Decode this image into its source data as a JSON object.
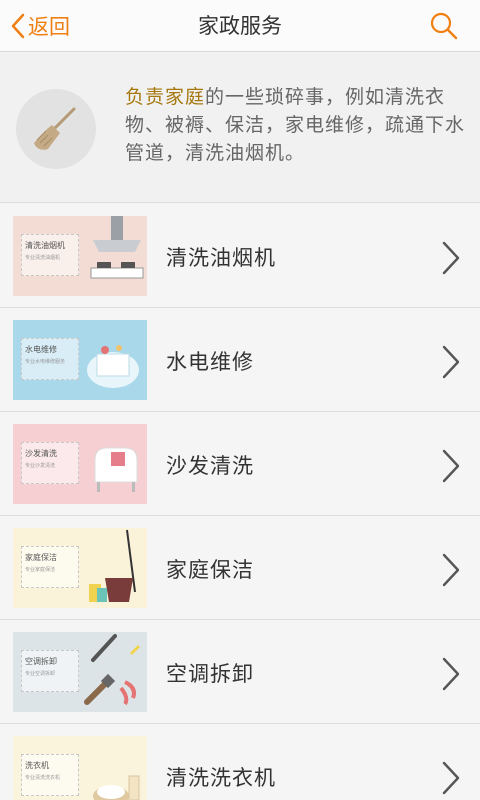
{
  "header": {
    "back_label": "返回",
    "title": "家政服务"
  },
  "intro": {
    "highlight": "负责家庭",
    "text": "的一些琐碎事，例如清洗衣物、被褥、保洁，家电维修，疏通下水管道，清洗油烟机。"
  },
  "services": [
    {
      "label": "清洗油烟机",
      "thumb_title": "清洗油烟机",
      "thumb_sub": "专业清洗油烟机",
      "thumb_bg": "#f2dcd3"
    },
    {
      "label": "水电维修",
      "thumb_title": "水电维修",
      "thumb_sub": "专业水电维修服务",
      "thumb_bg": "#a9d8ea"
    },
    {
      "label": "沙发清洗",
      "thumb_title": "沙发清洗",
      "thumb_sub": "专业沙发清洗",
      "thumb_bg": "#f6cfd3"
    },
    {
      "label": "家庭保洁",
      "thumb_title": "家庭保洁",
      "thumb_sub": "专业家庭保洁",
      "thumb_bg": "#faf3d9"
    },
    {
      "label": "空调拆卸",
      "thumb_title": "空调拆卸",
      "thumb_sub": "专业空调拆卸",
      "thumb_bg": "#dde4e8"
    },
    {
      "label": "清洗洗衣机",
      "thumb_title": "洗衣机",
      "thumb_sub": "专业清洗洗衣机",
      "thumb_bg": "#faf4dc"
    }
  ],
  "colors": {
    "accent": "#f07f12",
    "highlight": "#a5770e"
  }
}
